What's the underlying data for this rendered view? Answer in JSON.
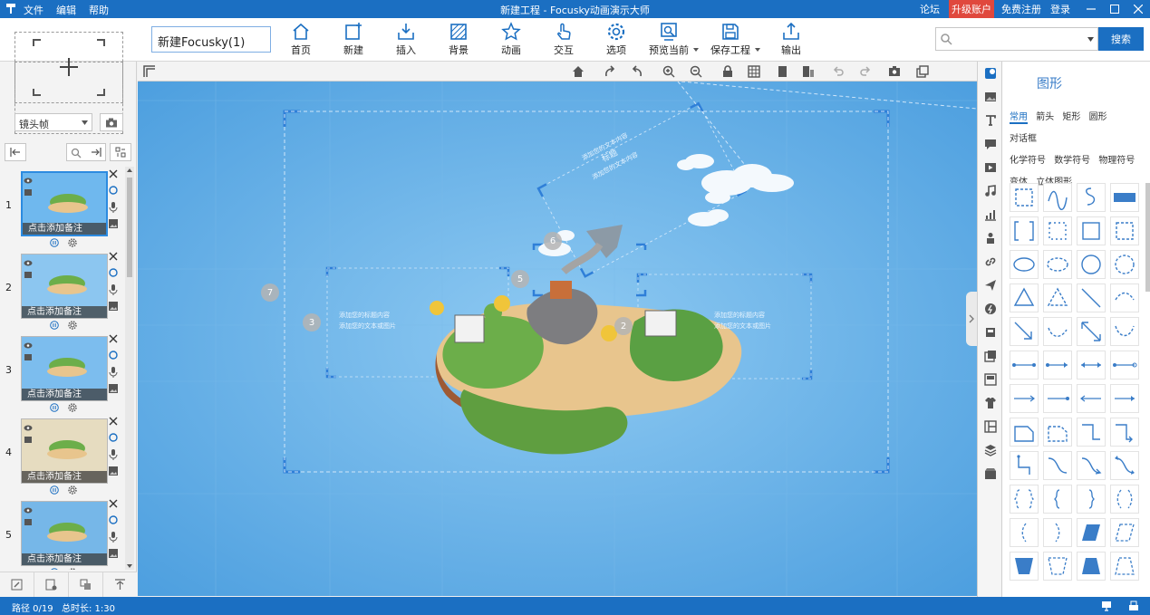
{
  "titlebar": {
    "menu": [
      "文件",
      "编辑",
      "帮助"
    ],
    "title": "新建工程 - Focusky动画演示大师",
    "links": {
      "forum": "论坛",
      "upgrade": "升级账户",
      "register": "免费注册",
      "login": "登录"
    }
  },
  "toolbar": {
    "project_name": "新建Focusky(1)",
    "buttons": [
      {
        "label": "首页",
        "icon": "home-icon"
      },
      {
        "label": "新建",
        "icon": "new-icon"
      },
      {
        "label": "插入",
        "icon": "insert-icon"
      },
      {
        "label": "背景",
        "icon": "background-icon"
      },
      {
        "label": "动画",
        "icon": "animation-icon"
      },
      {
        "label": "交互",
        "icon": "interaction-icon"
      },
      {
        "label": "选项",
        "icon": "options-icon"
      },
      {
        "label": "预览当前",
        "icon": "preview-icon"
      },
      {
        "label": "保存工程",
        "icon": "save-icon"
      },
      {
        "label": "输出",
        "icon": "export-icon"
      }
    ],
    "search_placeholder": "",
    "search_button": "搜索"
  },
  "leftpanel": {
    "frame_type": "镜头帧",
    "slides": [
      {
        "number": "1",
        "note": "点击添加备注",
        "active": true
      },
      {
        "number": "2",
        "note": "点击添加备注",
        "active": false
      },
      {
        "number": "3",
        "note": "点击添加备注",
        "active": false
      },
      {
        "number": "4",
        "note": "点击添加备注",
        "active": false
      },
      {
        "number": "5",
        "note": "点击添加备注",
        "active": false
      }
    ]
  },
  "canvas": {
    "markers": [
      "7",
      "3",
      "5",
      "6",
      "2"
    ],
    "frame_texts": {
      "left_line1": "添加您的标题内容",
      "left_line2": "添加您的文本或图片",
      "right_line1": "添加您的标题内容",
      "right_line2": "添加您的文本或图片",
      "top_title": "标题",
      "top_line1": "添加您的文本内容",
      "top_line2": "添加您的文本内容"
    }
  },
  "rightpanel": {
    "title": "图形",
    "categories": [
      "常用",
      "箭头",
      "矩形",
      "圆形",
      "对话框",
      "化学符号",
      "数学符号",
      "物理符号",
      "变体",
      "立体图形"
    ],
    "active_category": "常用"
  },
  "statusbar": {
    "path": "路径 0/19",
    "duration": "总时长: 1:30"
  },
  "colors": {
    "brand": "#1b6fc2",
    "canvas": "#5aabe7",
    "upgrade": "#e0483d",
    "frame": "#2f7fd8"
  }
}
